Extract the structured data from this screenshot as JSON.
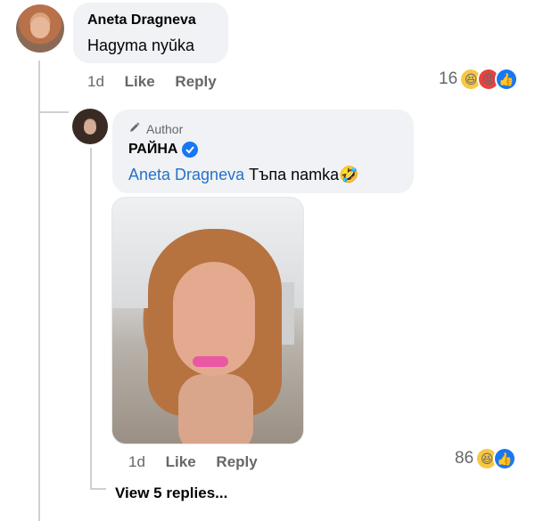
{
  "comment1": {
    "author": "Aneta Dragneva",
    "text": "Hagyma nyŭka",
    "age": "1d",
    "like_label": "Like",
    "reply_label": "Reply",
    "reaction_count": "16",
    "reaction_icons": [
      "haha-icon",
      "angry-icon",
      "like-icon"
    ]
  },
  "reply1": {
    "badge_label": "Author",
    "author": "РАЙНА",
    "mention": "Aneta Dragneva",
    "text": "Тъпа namka",
    "emoji": "🤣",
    "age": "1d",
    "like_label": "Like",
    "reply_label": "Reply",
    "reaction_count": "86",
    "reaction_icons": [
      "haha-icon",
      "like-icon"
    ]
  },
  "thread": {
    "view_more": "View 5 replies..."
  },
  "colors": {
    "bubble": "#f0f2f5",
    "mention": "#2672c8",
    "muted": "#65676b",
    "like_blue": "#1877f2"
  }
}
